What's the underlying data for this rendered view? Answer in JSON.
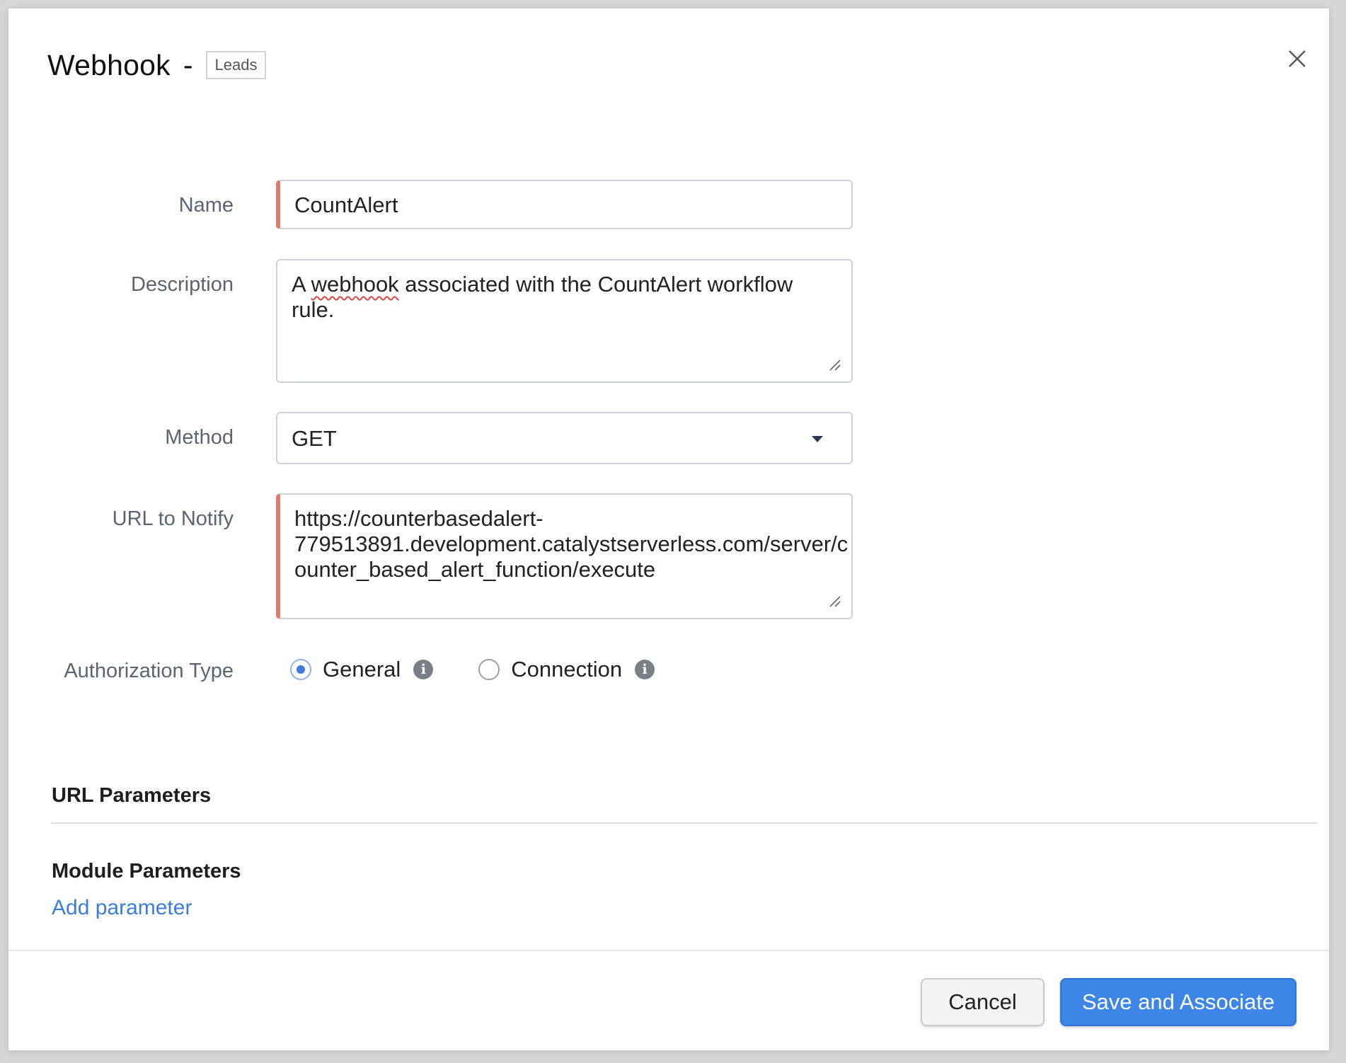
{
  "header": {
    "title": "Webhook",
    "separator": "-",
    "module_badge": "Leads"
  },
  "form": {
    "name": {
      "label": "Name",
      "value": "CountAlert"
    },
    "description": {
      "label": "Description",
      "value_prefix": "A ",
      "value_misspelled": "webhook",
      "value_suffix": " associated with the CountAlert workflow rule."
    },
    "method": {
      "label": "Method",
      "value": "GET"
    },
    "url": {
      "label": "URL to Notify",
      "line1": "https://counterbasedalert-",
      "line2": "779513891.development.catalystserverless.com/server/c",
      "line3": "ounter_based_alert_function/execute"
    },
    "authorization": {
      "label": "Authorization Type",
      "options": [
        {
          "label": "General",
          "checked": true
        },
        {
          "label": "Connection",
          "checked": false
        }
      ]
    }
  },
  "sections": {
    "url_parameters": "URL Parameters",
    "module_parameters": "Module Parameters",
    "add_parameter": "Add parameter"
  },
  "footer": {
    "cancel_label": "Cancel",
    "save_label": "Save and Associate"
  },
  "colors": {
    "accent": "#3d85e6",
    "required_marker": "#e07a6e",
    "link": "#3b7ddd"
  },
  "icons": {
    "close": "close-icon",
    "info": "info-icon",
    "dropdown": "chevron-down-icon",
    "resize": "resize-grip-icon"
  }
}
